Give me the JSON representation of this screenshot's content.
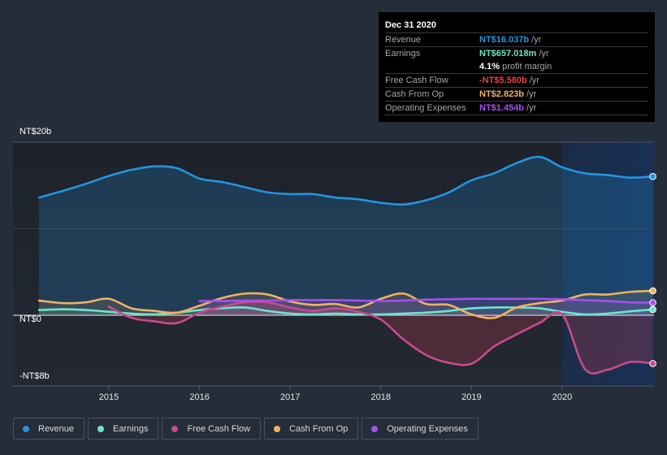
{
  "tooltip": {
    "date": "Dec 31 2020",
    "rows": [
      {
        "label": "Revenue",
        "value": "NT$16.037b",
        "unit": "/yr",
        "color": "#2394df"
      },
      {
        "label": "Earnings",
        "value": "NT$657.018m",
        "unit": "/yr",
        "color": "#6ce5cc"
      },
      {
        "label": "",
        "value": "4.1%",
        "unit": "profit margin",
        "color": "#ffffff"
      },
      {
        "label": "Free Cash Flow",
        "value": "-NT$5.580b",
        "unit": "/yr",
        "color": "#e64141"
      },
      {
        "label": "Cash From Op",
        "value": "NT$2.823b",
        "unit": "/yr",
        "color": "#f2b15f"
      },
      {
        "label": "Operating Expenses",
        "value": "NT$1.454b",
        "unit": "/yr",
        "color": "#a64ef0"
      }
    ]
  },
  "legend": [
    {
      "label": "Revenue",
      "color": "#2394df"
    },
    {
      "label": "Earnings",
      "color": "#6ce5cc"
    },
    {
      "label": "Free Cash Flow",
      "color": "#c84b8c"
    },
    {
      "label": "Cash From Op",
      "color": "#f2b15f"
    },
    {
      "label": "Operating Expenses",
      "color": "#a64ef0"
    }
  ],
  "chart_data": {
    "type": "line",
    "title": "",
    "xlabel": "",
    "ylabel": "",
    "y_tick_labels": [
      "NT$20b",
      "NT$0",
      "-NT$8b"
    ],
    "y_ticks": [
      20,
      0,
      -8
    ],
    "ylim": [
      -8,
      20
    ],
    "x_tick_labels": [
      "2015",
      "2016",
      "2017",
      "2018",
      "2019",
      "2020"
    ],
    "x_ticks": [
      2015,
      2016,
      2017,
      2018,
      2019,
      2020
    ],
    "xlim": [
      2013.77,
      2021.0
    ],
    "units": "NT$ billions",
    "highlight_range": [
      2020.0,
      2021.0
    ],
    "grid": true,
    "legend_position": "bottom-left",
    "series": [
      {
        "name": "Revenue",
        "color": "#2394df",
        "fill": true,
        "x": [
          2014.23,
          2014.5,
          2014.75,
          2015.0,
          2015.25,
          2015.5,
          2015.75,
          2016.0,
          2016.25,
          2016.5,
          2016.75,
          2017.0,
          2017.25,
          2017.5,
          2017.75,
          2018.0,
          2018.25,
          2018.5,
          2018.75,
          2019.0,
          2019.25,
          2019.5,
          2019.75,
          2020.0,
          2020.25,
          2020.5,
          2020.75,
          2021.0
        ],
        "y": [
          13.6,
          14.4,
          15.2,
          16.1,
          16.8,
          17.2,
          17.0,
          15.8,
          15.4,
          14.8,
          14.2,
          14.0,
          14.0,
          13.6,
          13.4,
          13.0,
          12.8,
          13.3,
          14.2,
          15.6,
          16.4,
          17.6,
          18.3,
          17.1,
          16.4,
          16.2,
          15.9,
          16.04
        ]
      },
      {
        "name": "Earnings",
        "color": "#6ce5cc",
        "fill": true,
        "x": [
          2014.23,
          2014.5,
          2014.75,
          2015.0,
          2015.25,
          2015.5,
          2015.75,
          2016.0,
          2016.25,
          2016.5,
          2016.75,
          2017.0,
          2017.25,
          2017.5,
          2017.75,
          2018.0,
          2018.25,
          2018.5,
          2018.75,
          2019.0,
          2019.25,
          2019.5,
          2019.75,
          2020.0,
          2020.25,
          2020.5,
          2020.75,
          2021.0
        ],
        "y": [
          0.6,
          0.7,
          0.6,
          0.4,
          0.2,
          0.1,
          0.3,
          0.6,
          0.8,
          0.9,
          0.5,
          0.2,
          0.1,
          0.2,
          0.1,
          0.1,
          0.2,
          0.3,
          0.5,
          0.8,
          0.9,
          0.9,
          0.8,
          0.4,
          0.1,
          0.2,
          0.45,
          0.66
        ]
      },
      {
        "name": "Free Cash Flow",
        "color": "#c84b8c",
        "fill": true,
        "x": [
          2015.0,
          2015.25,
          2015.5,
          2015.75,
          2016.0,
          2016.25,
          2016.5,
          2016.75,
          2017.0,
          2017.25,
          2017.5,
          2017.75,
          2018.0,
          2018.25,
          2018.5,
          2018.75,
          2019.0,
          2019.25,
          2019.5,
          2019.75,
          2020.0,
          2020.25,
          2020.5,
          2020.75,
          2021.0
        ],
        "y": [
          1.0,
          -0.3,
          -0.7,
          -0.9,
          0.3,
          1.0,
          1.5,
          1.5,
          0.9,
          0.5,
          0.8,
          0.4,
          -0.5,
          -2.8,
          -4.6,
          -5.5,
          -5.6,
          -3.6,
          -2.2,
          -0.9,
          0.1,
          -6.2,
          -6.3,
          -5.4,
          -5.58
        ]
      },
      {
        "name": "Cash From Op",
        "color": "#f2b15f",
        "fill": true,
        "x": [
          2014.23,
          2014.5,
          2014.75,
          2015.0,
          2015.25,
          2015.5,
          2015.75,
          2016.0,
          2016.25,
          2016.5,
          2016.75,
          2017.0,
          2017.25,
          2017.5,
          2017.75,
          2018.0,
          2018.25,
          2018.5,
          2018.75,
          2019.0,
          2019.25,
          2019.5,
          2019.75,
          2020.0,
          2020.25,
          2020.5,
          2020.75,
          2021.0
        ],
        "y": [
          1.7,
          1.4,
          1.5,
          1.9,
          0.8,
          0.5,
          0.3,
          1.1,
          2.0,
          2.5,
          2.4,
          1.6,
          1.2,
          1.3,
          0.9,
          1.9,
          2.5,
          1.3,
          1.2,
          0.1,
          -0.3,
          0.9,
          1.4,
          1.7,
          2.4,
          2.4,
          2.7,
          2.82
        ]
      },
      {
        "name": "Operating Expenses",
        "color": "#a64ef0",
        "fill": true,
        "x": [
          2016.0,
          2016.25,
          2016.5,
          2016.75,
          2017.0,
          2017.25,
          2017.5,
          2017.75,
          2018.0,
          2018.25,
          2018.5,
          2018.75,
          2019.0,
          2019.25,
          2019.5,
          2019.75,
          2020.0,
          2020.25,
          2020.5,
          2020.75,
          2021.0
        ],
        "y": [
          1.65,
          1.65,
          1.7,
          1.7,
          1.75,
          1.75,
          1.75,
          1.7,
          1.65,
          1.7,
          1.8,
          1.85,
          1.9,
          1.9,
          1.9,
          1.9,
          1.85,
          1.75,
          1.65,
          1.5,
          1.454
        ]
      }
    ]
  }
}
